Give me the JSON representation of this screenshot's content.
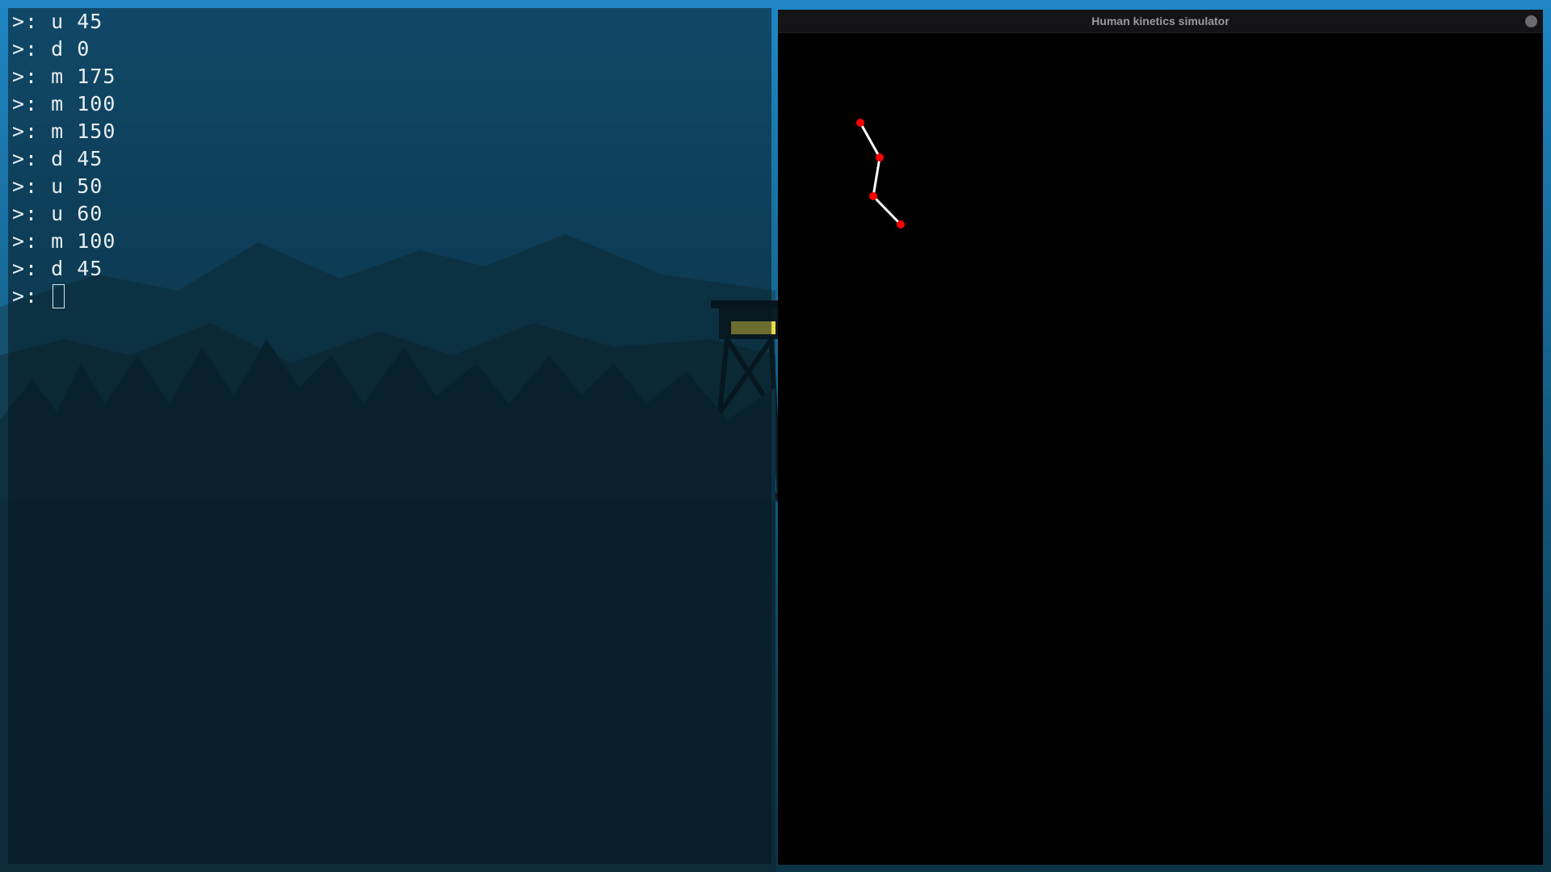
{
  "terminal": {
    "lines": [
      ">: u 45",
      ">: d 0",
      ">: m 175",
      ">: m 100",
      ">: m 150",
      ">: d 45",
      ">: u 50",
      ">: u 60",
      ">: m 100",
      ">: d 45"
    ],
    "prompt": ">:"
  },
  "simulator": {
    "title": "Human kinetics simulator",
    "joint_color": "#ff0000",
    "segment_color": "#ffffff"
  },
  "colors": {
    "sky_top": "#1f86c4",
    "sky_bottom": "#0f4d6e",
    "terminal_bg": "#06161e"
  }
}
